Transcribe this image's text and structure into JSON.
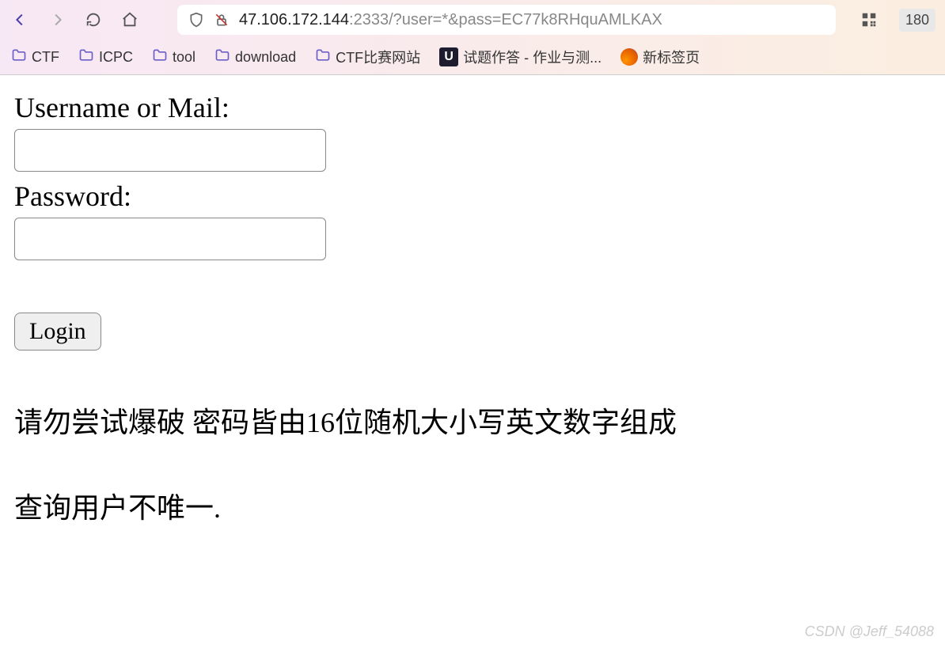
{
  "url": {
    "host": "47.106.172.144",
    "rest": ":2333/?user=*&pass=EC77k8RHquAMLKAX"
  },
  "zoom": "180",
  "bookmarks": [
    {
      "type": "folder",
      "label": "CTF"
    },
    {
      "type": "folder",
      "label": "ICPC"
    },
    {
      "type": "folder",
      "label": "tool"
    },
    {
      "type": "folder",
      "label": "download"
    },
    {
      "type": "folder",
      "label": "CTF比赛网站"
    },
    {
      "type": "u",
      "label": "试题作答 - 作业与测..."
    },
    {
      "type": "ff",
      "label": "新标签页"
    }
  ],
  "form": {
    "username_label": "Username or Mail:",
    "password_label": "Password:",
    "login_button": "Login"
  },
  "messages": {
    "notice": "请勿尝试爆破 密码皆由16位随机大小写英文数字组成",
    "result": "查询用户不唯一."
  },
  "watermark": "CSDN @Jeff_54088"
}
